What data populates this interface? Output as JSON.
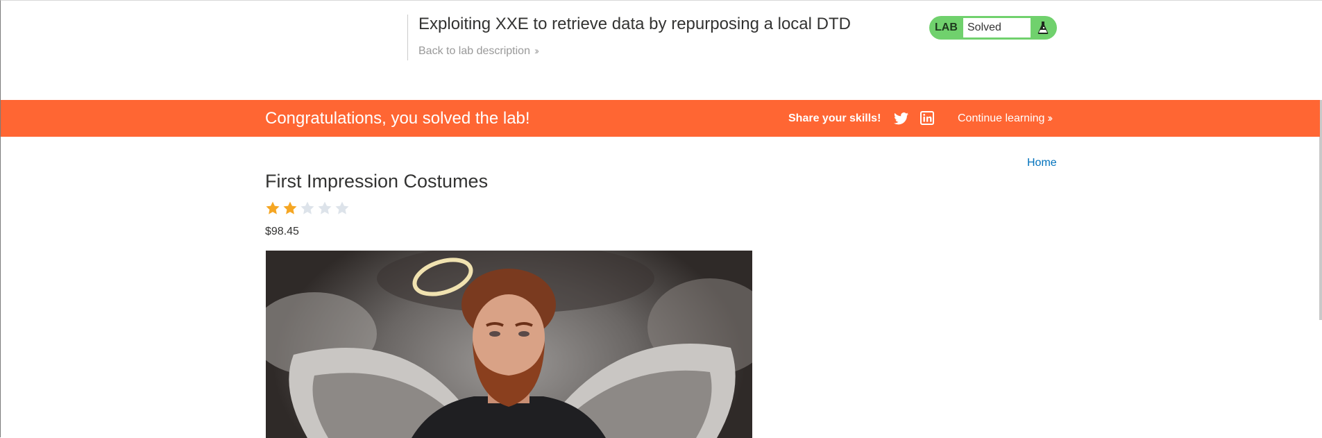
{
  "header": {
    "lab_title": "Exploiting XXE to retrieve data by repurposing a local DTD",
    "back_link": "Back to lab description",
    "lab_badge": "LAB",
    "lab_status": "Solved"
  },
  "banner": {
    "message": "Congratulations, you solved the lab!",
    "share_label": "Share your skills!",
    "continue_label": "Continue learning"
  },
  "nav": {
    "home": "Home"
  },
  "product": {
    "title": "First Impression Costumes",
    "rating": 2,
    "rating_max": 5,
    "price": "$98.45"
  },
  "colors": {
    "banner": "#ff6633",
    "lab_green": "#70d16d",
    "link_blue": "#0071bc",
    "star_filled": "#f5a623",
    "star_empty": "#dde3ea"
  },
  "icons": [
    "chevron-right-icon",
    "flask-icon",
    "twitter-icon",
    "linkedin-icon",
    "star-icon"
  ]
}
